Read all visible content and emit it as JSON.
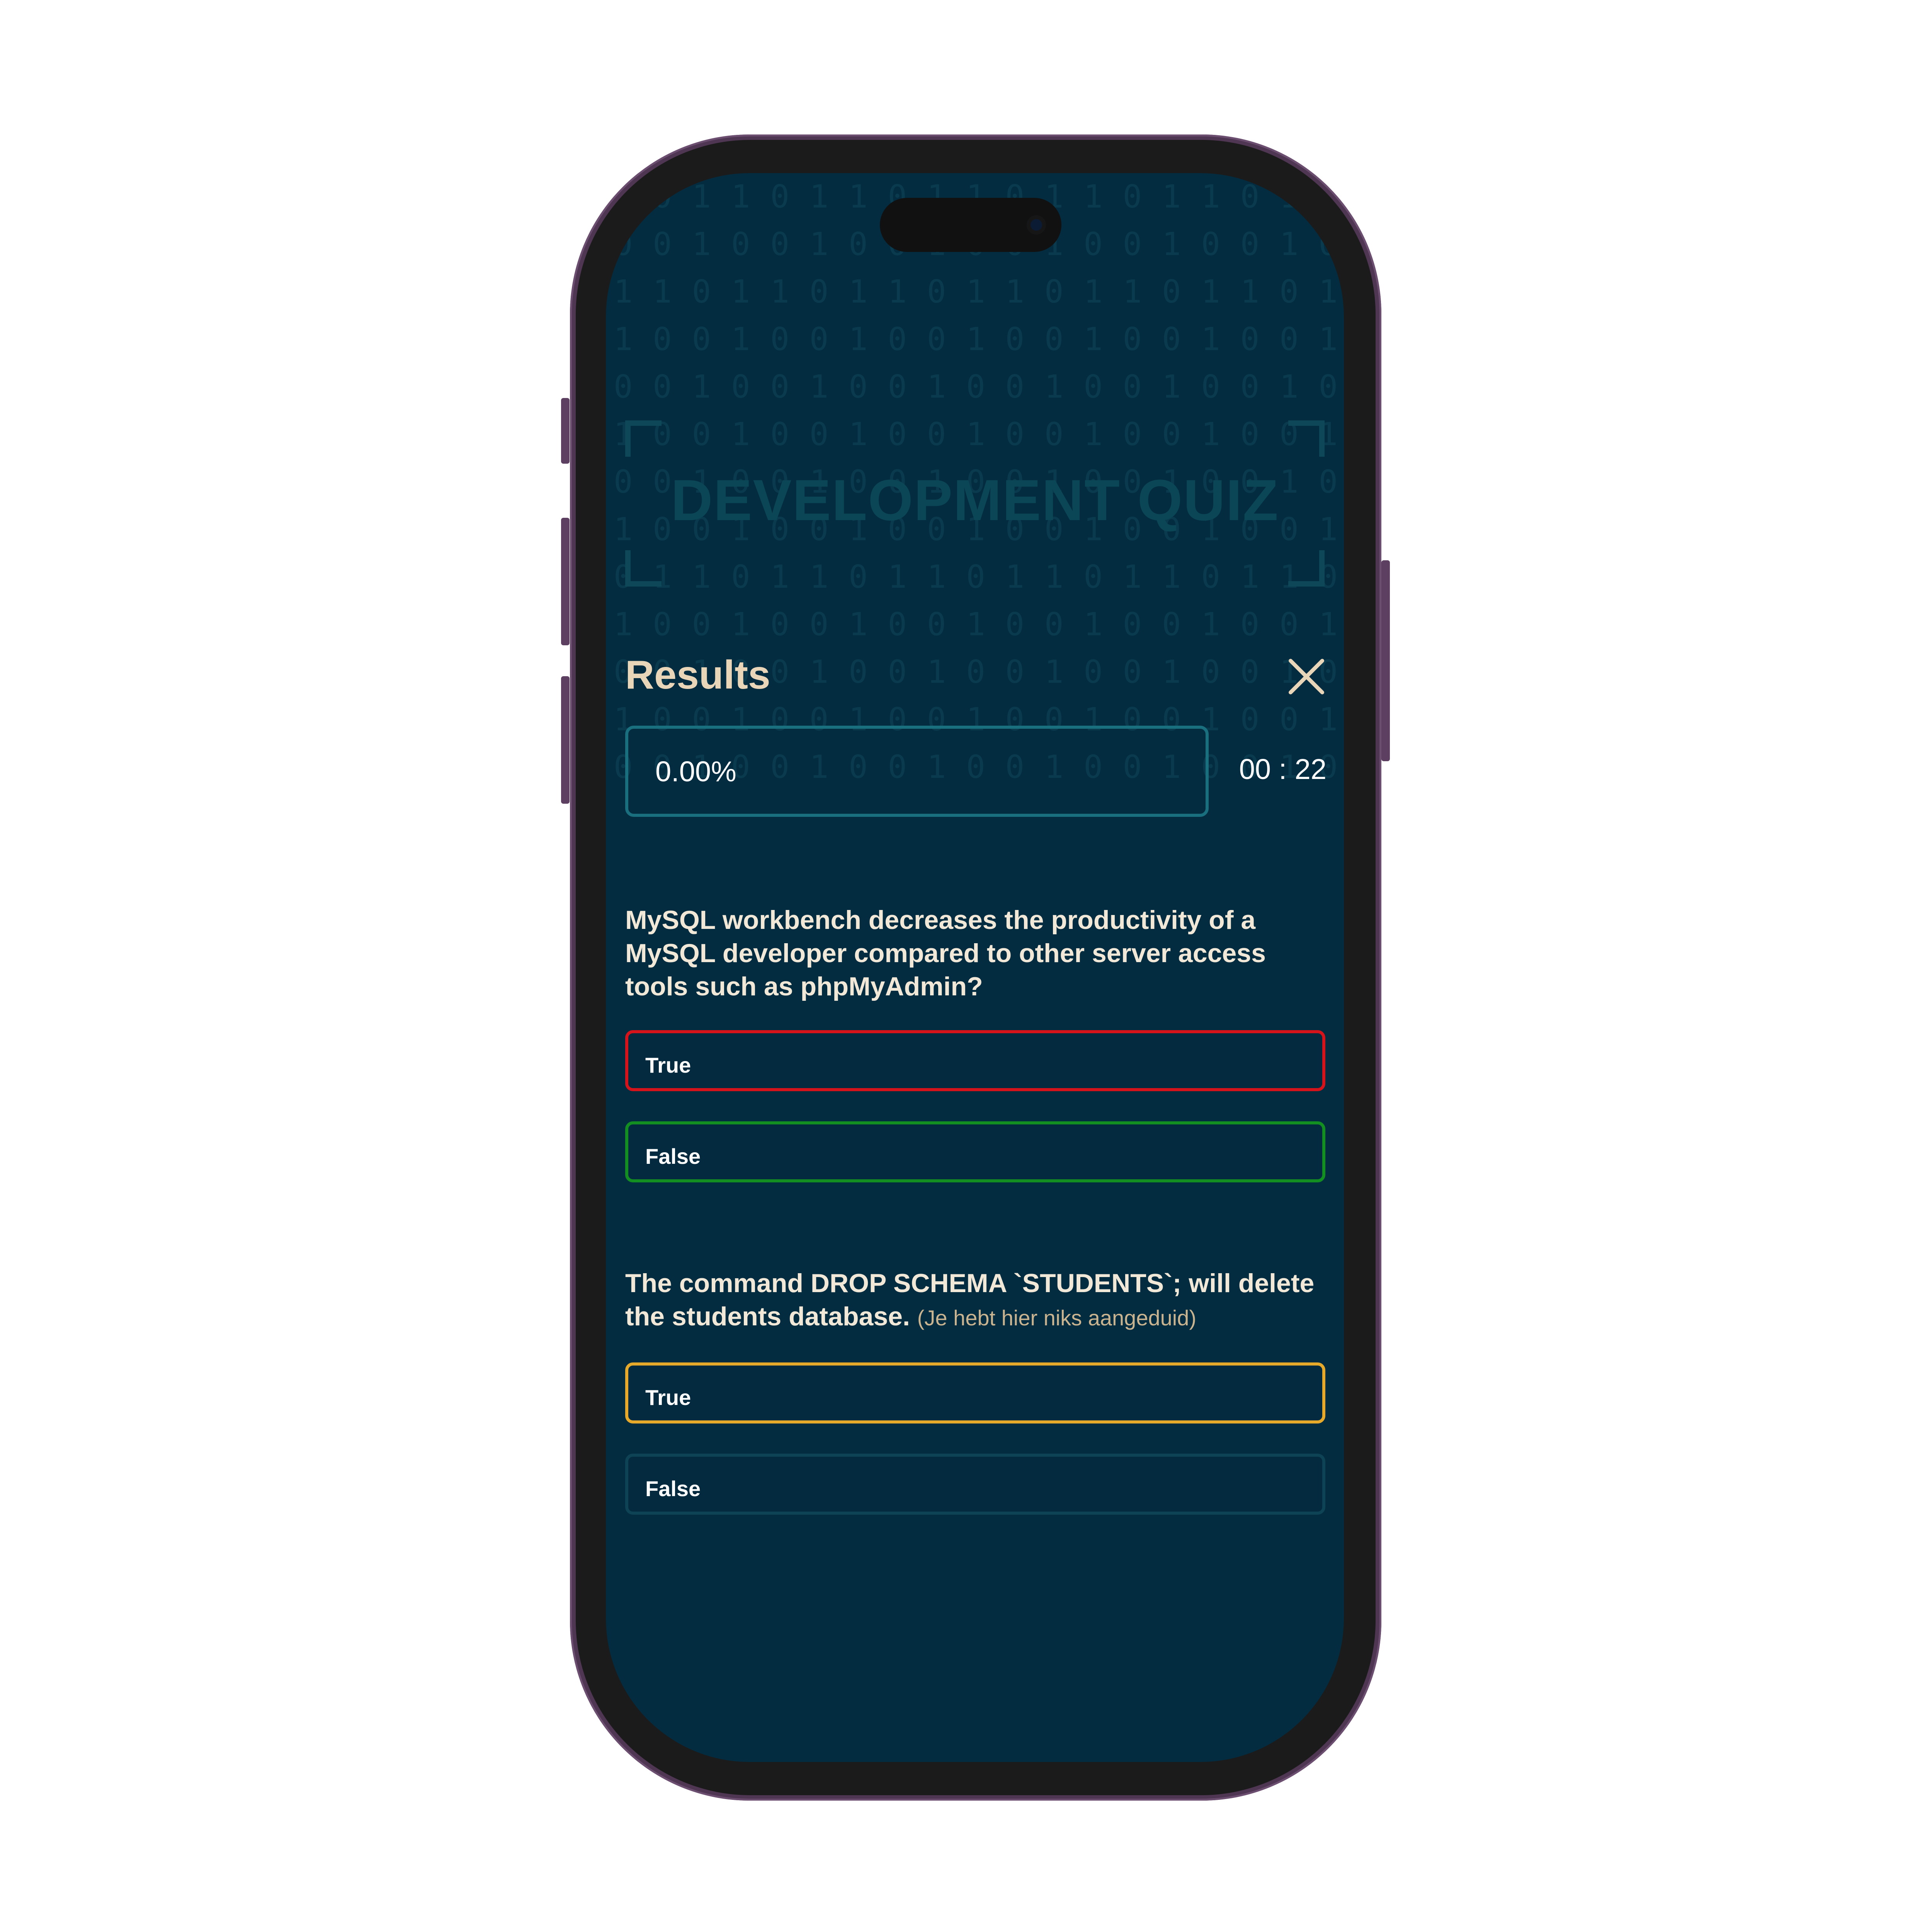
{
  "quiz": {
    "title": "DEVELOPMENT QUIZ"
  },
  "results": {
    "title": "Results",
    "score": "0.00%",
    "timer": "00 : 22"
  },
  "questions": [
    {
      "text": "MySQL workbench decreases the productivity of a MySQL developer compared to other server access tools such as phpMyAdmin?",
      "note": "",
      "options": [
        {
          "label": "True",
          "state": "wrong"
        },
        {
          "label": "False",
          "state": "correct"
        }
      ]
    },
    {
      "text": "The command DROP SCHEMA `STUDENTS`; will delete the students database.",
      "note": "(Je hebt hier niks aangeduid)",
      "options": [
        {
          "label": "True",
          "state": "correct-unanswered"
        },
        {
          "label": "False",
          "state": "neutral"
        }
      ]
    }
  ],
  "icons": {
    "close": "close-icon"
  },
  "colors": {
    "background": "#042c40",
    "accent": "#e9d6b9",
    "wrong": "#d4131b",
    "correct": "#138f21",
    "missed": "#e7a92a",
    "frame": "#4f3653"
  }
}
